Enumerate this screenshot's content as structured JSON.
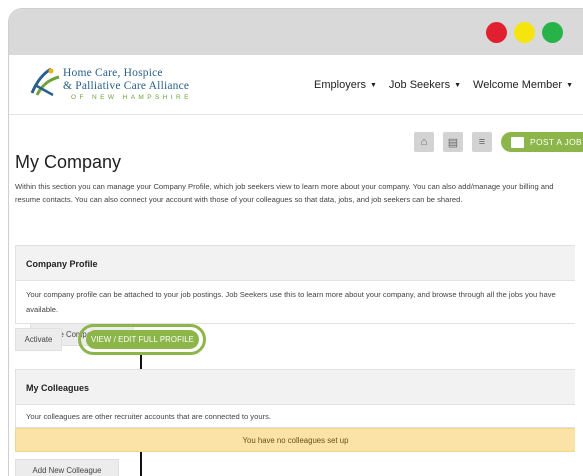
{
  "window": {
    "controls": [
      {
        "name": "close",
        "color": "#e0202e"
      },
      {
        "name": "minimize",
        "color": "#f6e40e"
      },
      {
        "name": "maximize",
        "color": "#27b34a"
      }
    ]
  },
  "brand": {
    "line1": "Home Care, Hospice",
    "line2": "& Palliative Care Alliance",
    "line3": "OF NEW HAMPSHIRE",
    "colors": {
      "primary": "#2a5f8a",
      "accent": "#6fa23b"
    }
  },
  "nav": {
    "items": [
      {
        "label": "Employers"
      },
      {
        "label": "Job Seekers"
      },
      {
        "label": "Welcome Member"
      }
    ]
  },
  "toolbar": {
    "icons": [
      "home-icon",
      "search-resume-icon",
      "list-icon"
    ],
    "post_job": "POST A JOB"
  },
  "page": {
    "title": "My Company",
    "intro": "Within this section you can manage your Company Profile, which job seekers view to learn more about your company. You can also add/manage your billing and resume contacts. You can also connect your account with those of your colleagues so that data, jobs, and job seekers can be shared."
  },
  "company_profile": {
    "heading": "Company Profile",
    "description": "Your company profile can be attached to your job postings. Job Seekers use this to learn more about your company, and browse through all the jobs you have available.",
    "create_button": "Create Company Profile",
    "activate_button": "Activate",
    "view_button": "VIEW / EDIT FULL PROFILE"
  },
  "colleagues": {
    "heading": "My Colleagues",
    "description": "Your colleagues are other recruiter accounts that are connected to yours.",
    "notice": "You have no colleagues set up",
    "add_button": "Add New Colleague"
  },
  "colors": {
    "accent_green": "#8cb54a",
    "notice_bg": "#fbe3a8"
  }
}
